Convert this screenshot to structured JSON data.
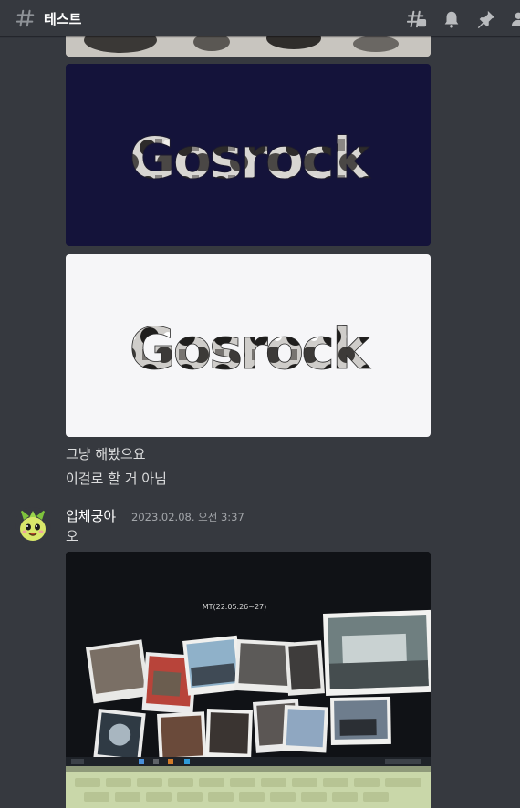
{
  "header": {
    "channel_name": "테스트",
    "icons": [
      "hash-icon",
      "threads-icon",
      "bell-icon",
      "pin-icon",
      "members-icon"
    ]
  },
  "messages": {
    "line1": "그냥 해봤으요",
    "line2": "이걸로 할 거 아님",
    "author": "입체쿵야",
    "timestamp": "2023.02.08. 오전 3:37",
    "text": "오"
  },
  "images": {
    "logo_text": "Gosrock",
    "photo_screen_caption": "MT(22.05.26~27)"
  },
  "colors": {
    "background": "#36393f",
    "dark_banner": "#14133a",
    "light_banner": "#f6f6f8",
    "text": "#dcddde",
    "muted": "#a3a6aa"
  }
}
